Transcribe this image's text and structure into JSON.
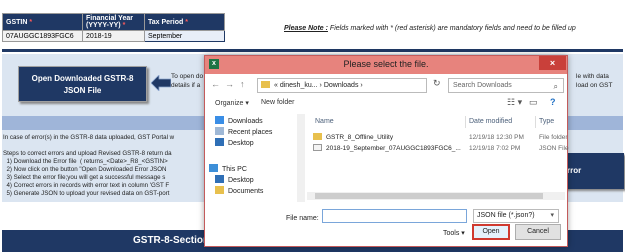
{
  "sheet": {
    "headers": {
      "gstin": "GSTIN",
      "fy": "Financial Year (YYYY-YY)",
      "tax_period": "Tax Period",
      "req_mark": "*"
    },
    "row": {
      "gstin": "07AUGGC1893FGC6",
      "fy": "2018-19",
      "tax_period": "September"
    },
    "note_prefix": "Please Note :",
    "note_text": " Fields marked with * (red asterisk) are mandatory fields and need to be filled up",
    "open_json_button": "Open Downloaded GSTR-8\nJSON File",
    "open_desc": "To open do\ndetails if a",
    "right_desc": "le with data\nload on GST",
    "steps_text": "In case of error(s) in the GSTR-8 data uploaded, GST Portal w\n\nSteps to correct errors and upload Revised GSTR-8 return da\n  1) Download the Error file  ( returns_<Date>_R8_<GSTIN>\n  2) Now click on the button \"Open Downloaded Error JSON\n  3) Select the error file;you will get a successful message s\n  4) Correct errors in records with error text in column 'GST F\n  5) Generate JSON to upload your revised data on GST-port",
    "error_button": "rror",
    "section_title": "GSTR-8-Section"
  },
  "dialog": {
    "title": "Please select the file.",
    "close_symbol": "×",
    "app_icon": "x",
    "nav": {
      "back": "←",
      "forward": "→",
      "up": "↑",
      "refresh": "↻"
    },
    "address": [
      "«",
      "dinesh_ku...",
      "›",
      "Downloads",
      "›"
    ],
    "search_placeholder": "Search Downloads",
    "toolbar": {
      "organize": "Organize ▾",
      "new_folder": "New folder",
      "view_icon": "☷ ▾",
      "help": "?"
    },
    "sidebar": [
      "Downloads",
      "Recent places",
      "Desktop",
      "This PC",
      "Desktop",
      "Documents"
    ],
    "columns": [
      "Name",
      "Date modified",
      "Type"
    ],
    "files": [
      {
        "name": "GSTR_8_Offline_Utility",
        "date": "12/19/18 12:30 PM",
        "type": "File folder"
      },
      {
        "name": "2018-19_September_07AUGGC1893FGC6_...",
        "date": "12/19/18 7:02 PM",
        "type": "JSON File"
      }
    ],
    "file_name_label": "File name:",
    "file_name_value": "",
    "file_type": "JSON file (*.json?)",
    "tools_label": "Tools ▾",
    "open_label": "Open",
    "cancel_label": "Cancel"
  },
  "colors": {
    "header_navy": "#1f3864",
    "dialog_title": "#e7837d",
    "close_red": "#c9403a",
    "highlight_red": "#d0392f"
  }
}
